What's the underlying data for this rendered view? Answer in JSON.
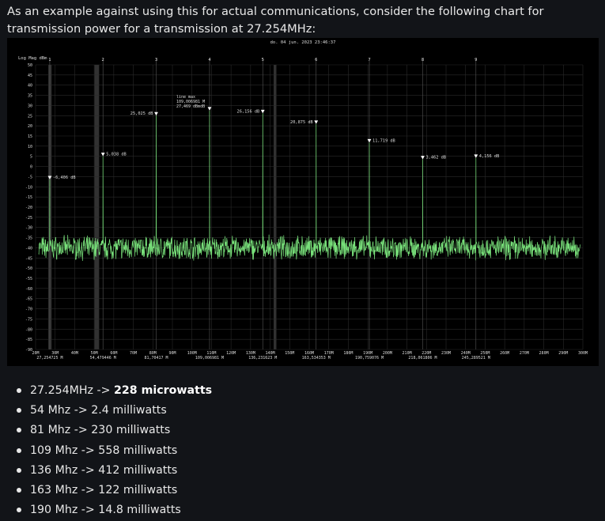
{
  "intro": {
    "text": "As an example against using this for actual communications, consider the following chart for transmission power for a transmission at 27.254MHz:"
  },
  "chart_data": {
    "type": "line",
    "timestamp": "do. 04 jun. 2023 23:46:37",
    "ylabel": "Log Mag dBm",
    "ylim": [
      -90,
      50
    ],
    "xlim": [
      20,
      300
    ],
    "x_unit": "MHz",
    "grid": true,
    "y_ticks": [
      50,
      45,
      40,
      35,
      30,
      25,
      20,
      15,
      10,
      5,
      0,
      -5,
      -10,
      -15,
      -20,
      -25,
      -30,
      -35,
      -40,
      -45,
      -50,
      -55,
      -60,
      -65,
      -70,
      -75,
      -80,
      -85,
      -90
    ],
    "x_ticks": [
      {
        "v": 20,
        "label": "20M"
      },
      {
        "v": 30,
        "label": "30M"
      },
      {
        "v": 40,
        "label": "40M"
      },
      {
        "v": 50,
        "label": "50M"
      },
      {
        "v": 60,
        "label": "60M"
      },
      {
        "v": 70,
        "label": "70M"
      },
      {
        "v": 80,
        "label": "80M"
      },
      {
        "v": 90,
        "label": "90M"
      },
      {
        "v": 100,
        "label": "100M"
      },
      {
        "v": 110,
        "label": "110M"
      },
      {
        "v": 120,
        "label": "120M"
      },
      {
        "v": 130,
        "label": "130M"
      },
      {
        "v": 140,
        "label": "140M"
      },
      {
        "v": 150,
        "label": "150M"
      },
      {
        "v": 160,
        "label": "160M"
      },
      {
        "v": 170,
        "label": "170M"
      },
      {
        "v": 180,
        "label": "180M"
      },
      {
        "v": 190,
        "label": "190M"
      },
      {
        "v": 200,
        "label": "200M"
      },
      {
        "v": 210,
        "label": "210M"
      },
      {
        "v": 220,
        "label": "220M"
      },
      {
        "v": 230,
        "label": "230M"
      },
      {
        "v": 240,
        "label": "240M"
      },
      {
        "v": 250,
        "label": "250M"
      },
      {
        "v": 260,
        "label": "260M"
      },
      {
        "v": 270,
        "label": "270M"
      },
      {
        "v": 280,
        "label": "280M"
      },
      {
        "v": 290,
        "label": "290M"
      },
      {
        "v": 300,
        "label": "300M"
      }
    ],
    "noise_floor_dbm": -40,
    "markers": [
      {
        "id": "1",
        "freq_mhz": 27.254725,
        "freq_label": "27,254725 M",
        "level_db": -6.406,
        "level_label": "-6,406 dB"
      },
      {
        "id": "2",
        "freq_mhz": 54.479446,
        "freq_label": "54,479446 M",
        "level_db": 5.038,
        "level_label": "5,038 dB"
      },
      {
        "id": "3",
        "freq_mhz": 81.70417,
        "freq_label": "81,70417 M",
        "level_db": 25.025,
        "level_label": "25,025 dB"
      },
      {
        "id": "4",
        "freq_mhz": 109.006981,
        "freq_label": "109,006981 M",
        "level_db": 27.469,
        "level_label": "27,469 dBmdB",
        "annotation": [
          "line max",
          "109,006981 M",
          "27,469 dBmdB"
        ]
      },
      {
        "id": "5",
        "freq_mhz": 136.231623,
        "freq_label": "136,231623 M",
        "level_db": 26.156,
        "level_label": "26,156 dB"
      },
      {
        "id": "6",
        "freq_mhz": 163.534353,
        "freq_label": "163,534353 M",
        "level_db": 20.875,
        "level_label": "20,875 dB"
      },
      {
        "id": "7",
        "freq_mhz": 190.759076,
        "freq_label": "190,759076 M",
        "level_db": 11.719,
        "level_label": "11,719 dB"
      },
      {
        "id": "8",
        "freq_mhz": 218.061806,
        "freq_label": "218,061806 M",
        "level_db": 3.462,
        "level_label": "3,462 dB"
      },
      {
        "id": "9",
        "freq_mhz": 245.289521,
        "freq_label": "245,289521 M",
        "level_db": 4.156,
        "level_label": "4,156 dB"
      }
    ],
    "colors": {
      "trace": "#78e07a",
      "marker": "#ffffff",
      "grid": "#2a2a2a",
      "band": "#3a3a3a",
      "background": "#000000",
      "text": "#dddddd"
    }
  },
  "bullets": [
    {
      "prefix": "27.254MHz -> ",
      "bold": "228 microwatts",
      "suffix": ""
    },
    {
      "prefix": "54 Mhz -> 2.4 milliwatts",
      "bold": "",
      "suffix": ""
    },
    {
      "prefix": "81 Mhz -> 230 milliwatts",
      "bold": "",
      "suffix": ""
    },
    {
      "prefix": "109 Mhz -> 558 milliwatts",
      "bold": "",
      "suffix": ""
    },
    {
      "prefix": "136 Mhz -> 412 milliwatts",
      "bold": "",
      "suffix": ""
    },
    {
      "prefix": "163 Mhz -> 122 milliwatts",
      "bold": "",
      "suffix": ""
    },
    {
      "prefix": "190 Mhz -> 14.8 milliwatts",
      "bold": "",
      "suffix": ""
    }
  ]
}
